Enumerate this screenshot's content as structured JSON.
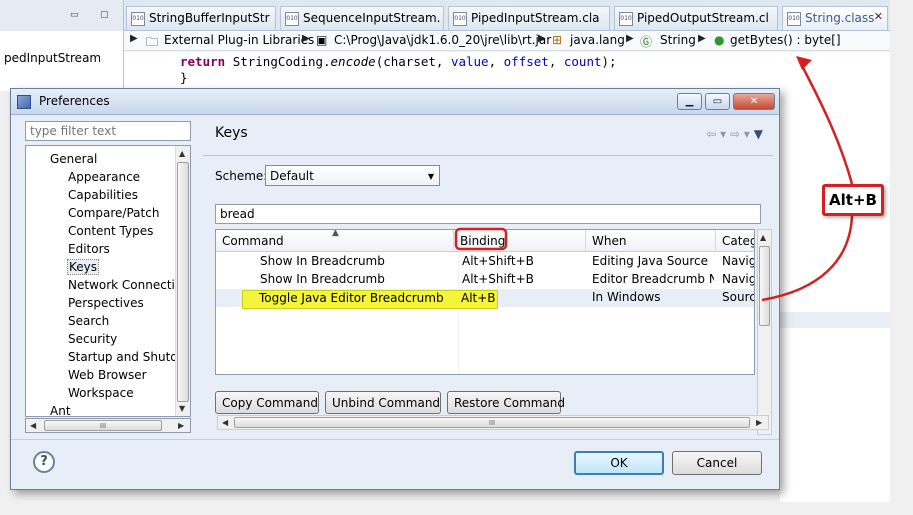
{
  "ide": {
    "left_view_label": "pedInputStream",
    "tabs": [
      {
        "label": "StringBufferInputStr"
      },
      {
        "label": "SequenceInputStream."
      },
      {
        "label": "PipedInputStream.cla"
      },
      {
        "label": "PipedOutputStream.cl"
      },
      {
        "label": "String.class"
      }
    ],
    "breadcrumb": [
      "External Plug-in Libraries",
      "C:\\Prog\\Java\\jdk1.6.0_20\\jre\\lib\\rt.jar",
      "java.lang",
      "String",
      "getBytes() : byte[]"
    ],
    "code": {
      "keyword": "return",
      "class_name": "StringCoding.",
      "method": "encode",
      "open": "(charset, ",
      "arg_value": "value",
      "sep1": ", ",
      "arg_offset": "offset",
      "sep2": ", ",
      "arg_count": "count",
      "close": ");",
      "brace": "}"
    }
  },
  "dialog": {
    "title": "Preferences",
    "filter_placeholder": "type filter text",
    "tree": {
      "items": [
        "General",
        "Appearance",
        "Capabilities",
        "Compare/Patch",
        "Content Types",
        "Editors",
        "Keys",
        "Network Connection",
        "Perspectives",
        "Search",
        "Security",
        "Startup and Shutdov",
        "Web Browser",
        "Workspace",
        "Ant"
      ],
      "selected": "Keys"
    },
    "page": {
      "title": "Keys",
      "scheme_label": "Scheme:",
      "scheme_value": "Default",
      "search_value": "bread",
      "columns": [
        "Command",
        "Binding",
        "When",
        "Categ"
      ],
      "rows": [
        {
          "command": "Show In Breadcrumb",
          "binding": "Alt+Shift+B",
          "when": "Editing Java Source",
          "category": "Navig"
        },
        {
          "command": "Show In Breadcrumb",
          "binding": "Alt+Shift+B",
          "when": "Editor Breadcrumb N...",
          "category": "Navig"
        },
        {
          "command": "Toggle Java Editor Breadcrumb",
          "binding": "Alt+B",
          "when": "In Windows",
          "category": "Sourc"
        }
      ],
      "buttons": {
        "copy": "Copy Command",
        "unbind": "Unbind Command",
        "restore": "Restore Command"
      }
    },
    "footer": {
      "ok": "OK",
      "cancel": "Cancel"
    }
  },
  "annotation": {
    "callout_text": "Alt+B",
    "color": "#d52020"
  }
}
